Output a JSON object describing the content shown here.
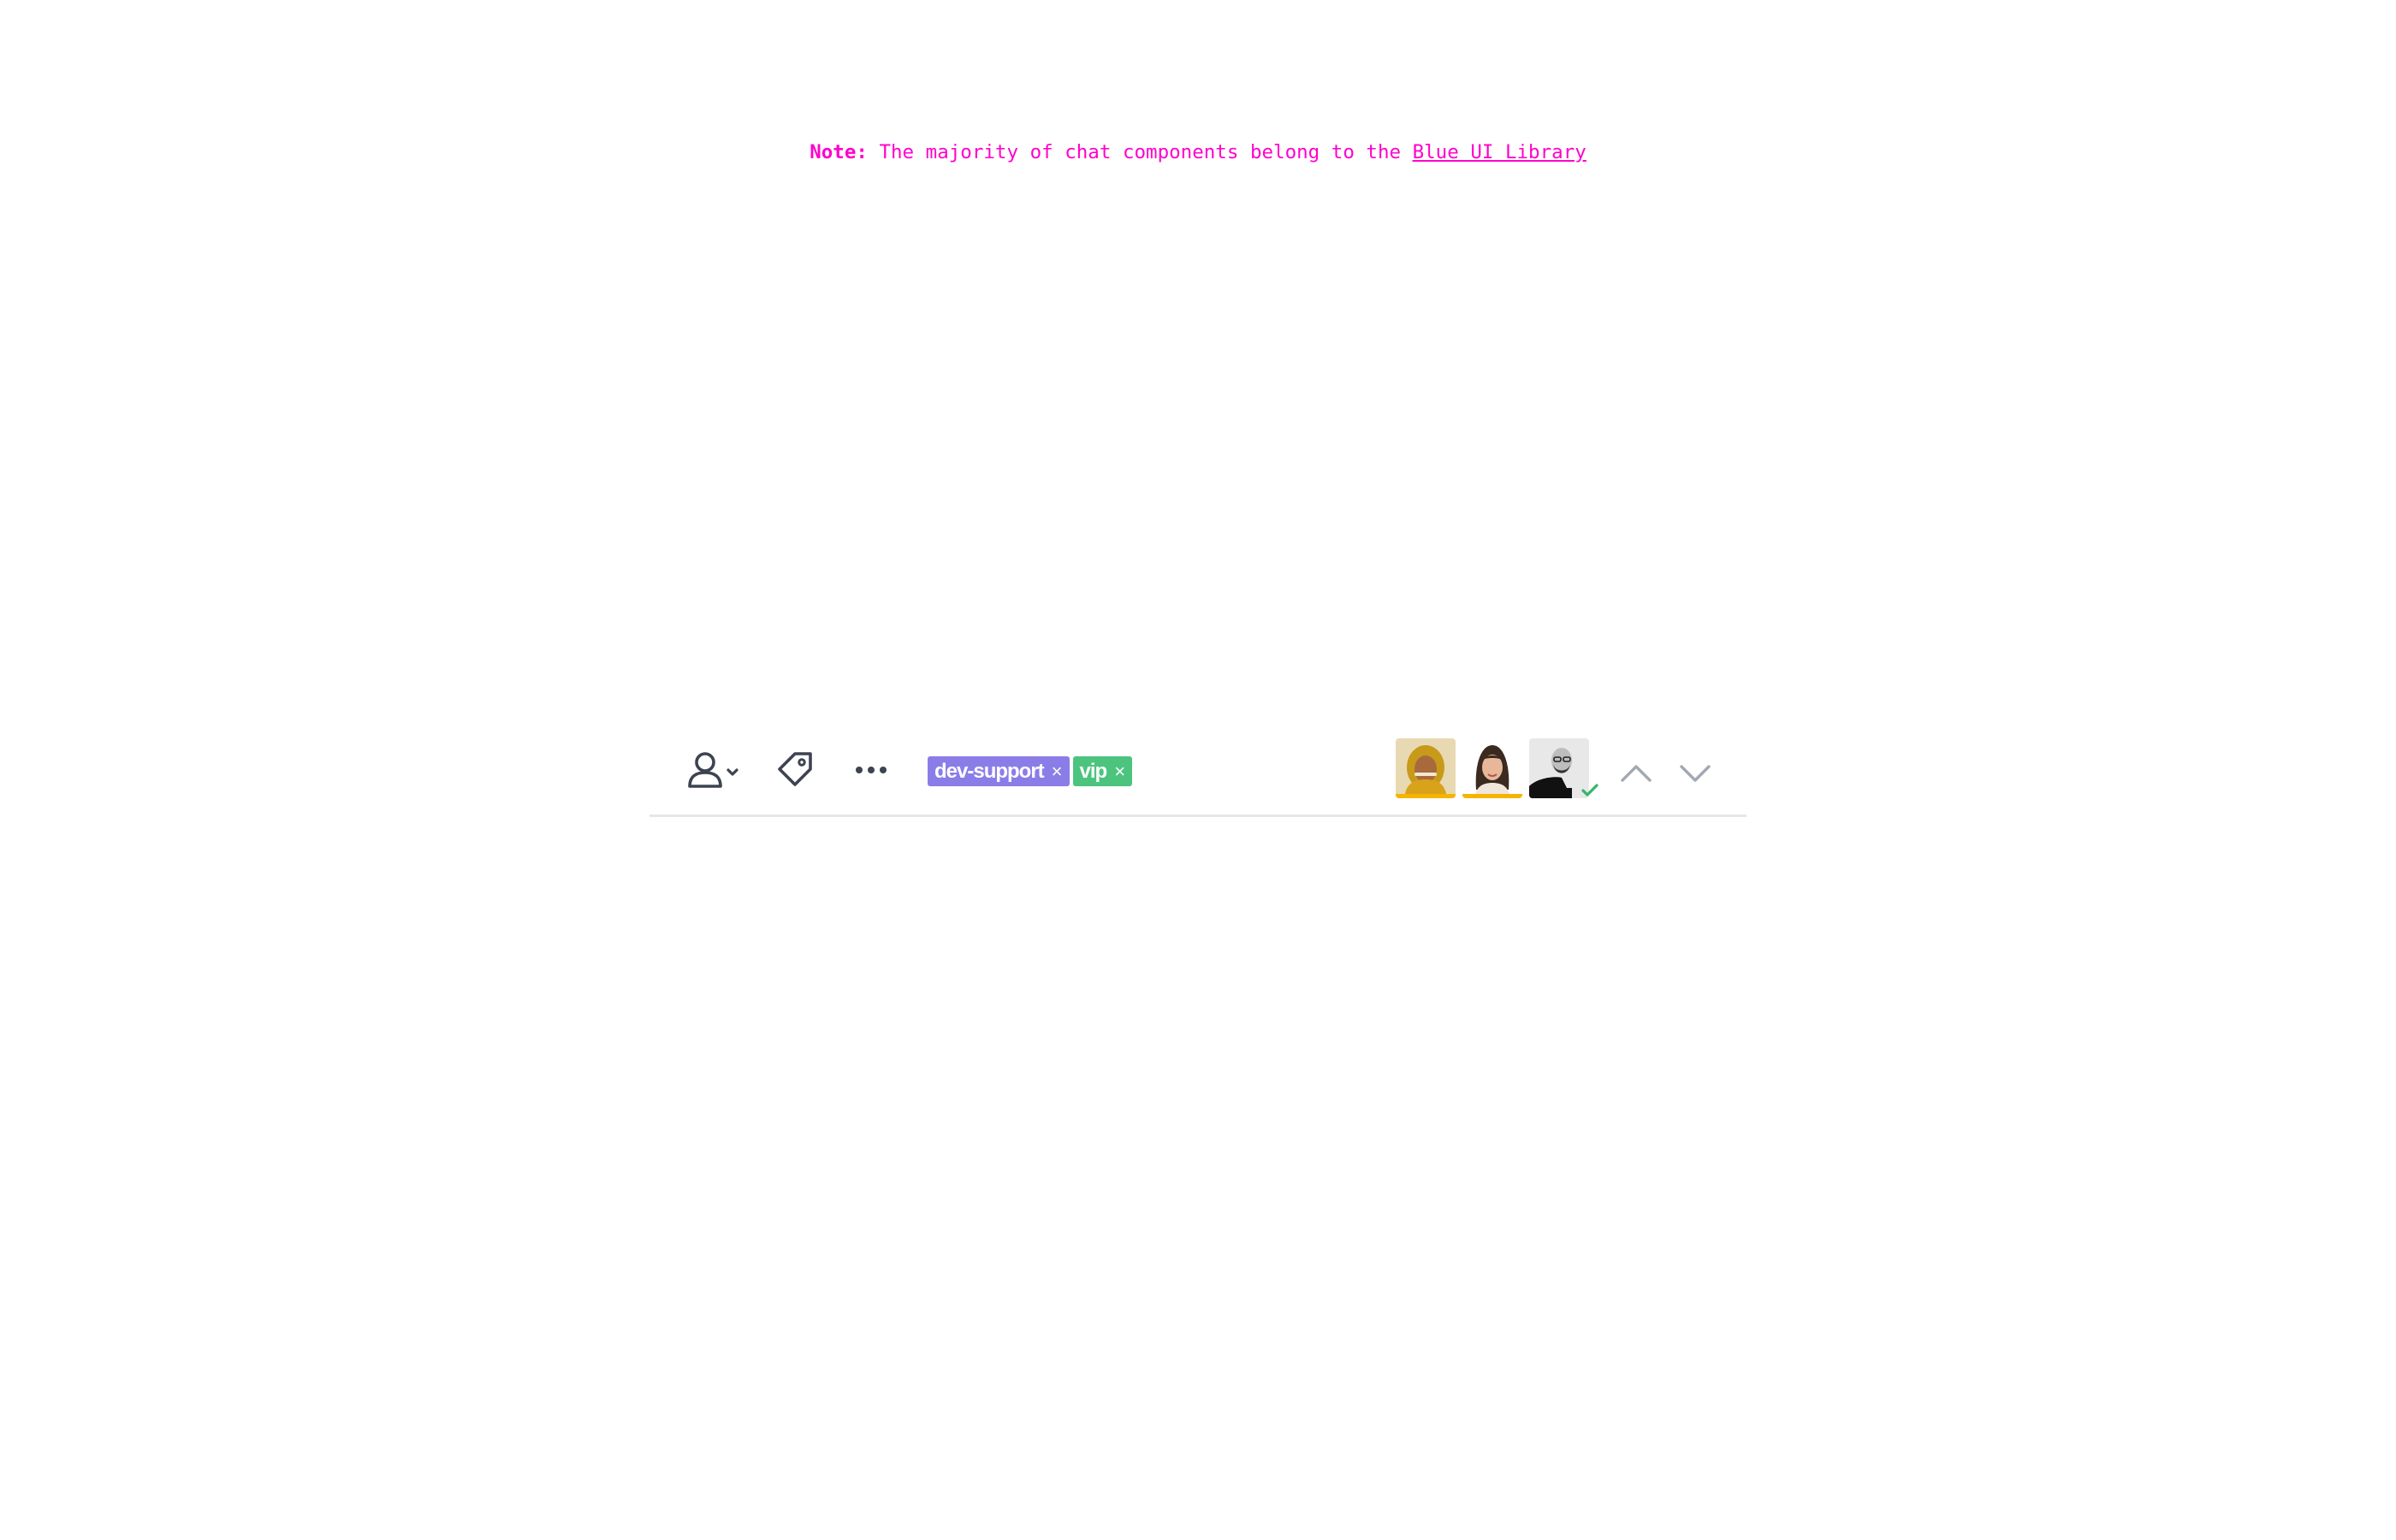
{
  "note": {
    "label": "Note:",
    "text": "The majority of chat components belong to the",
    "link": "Blue UI Library",
    "color": "#ff00cc"
  },
  "toolbar": {
    "assign_icon": "user-assign-icon",
    "tag_icon": "tag-icon",
    "more_icon": "more-horizontal-icon",
    "tags": [
      {
        "label": "dev-support",
        "remove": "×",
        "color": "#8b7de8"
      },
      {
        "label": "vip",
        "remove": "×",
        "color": "#4cc47e"
      }
    ],
    "participants": [
      {
        "name": "participant-1",
        "status_color": "#f5b400"
      },
      {
        "name": "participant-2",
        "status_color": "#f5b400"
      },
      {
        "name": "participant-3",
        "status": "online-check",
        "status_color": "#35b56b"
      }
    ],
    "nav_up_icon": "chevron-up-icon",
    "nav_down_icon": "chevron-down-icon",
    "icon_color": "#3d4350",
    "nav_color": "#a3a9b3",
    "divider_color": "#e5e7ea"
  }
}
